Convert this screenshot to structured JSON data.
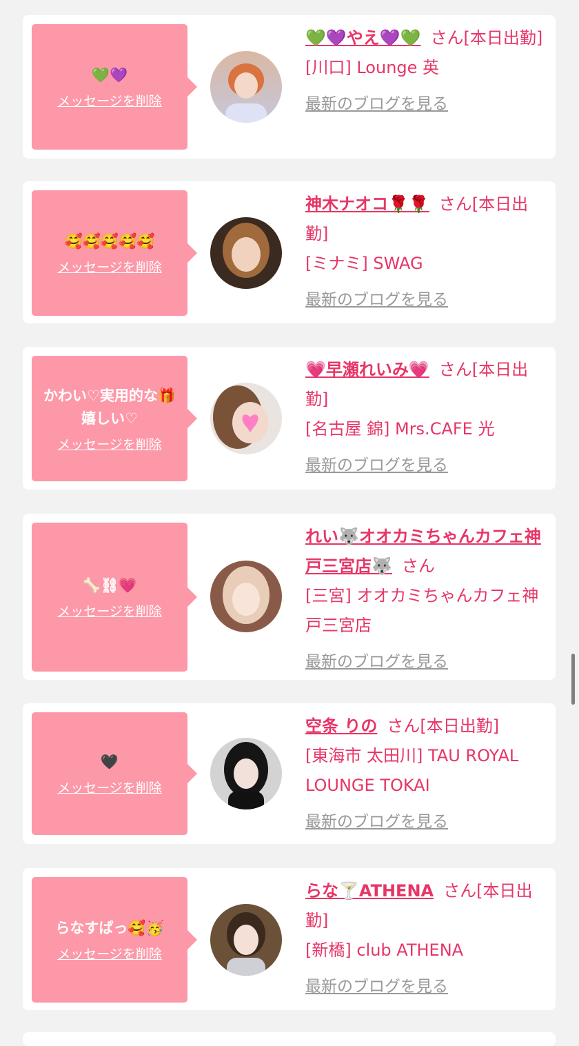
{
  "cards": [
    {
      "message": "💚💜",
      "delete_label": "メッセージを削除",
      "name": "💚💜やえ💜💚",
      "san": "さん",
      "status": "[本日出勤]",
      "place": "[川口] Lounge 英",
      "blog": "最新のブログを見る"
    },
    {
      "message": "🥰🥰🥰🥰🥰",
      "delete_label": "メッセージを削除",
      "name": "神木ナオコ🌹🌹",
      "san": "さん",
      "status": "[本日出勤]",
      "place": "[ミナミ] SWAG",
      "blog": "最新のブログを見る"
    },
    {
      "message": "かわい♡実用的な🎁嬉しい♡",
      "delete_label": "メッセージを削除",
      "name": "💗早瀬れいみ💗",
      "san": "さん",
      "status": "[本日出勤]",
      "place": "[名古屋 錦] Mrs.CAFE 光",
      "blog": "最新のブログを見る"
    },
    {
      "message": "🦴⛓💗",
      "delete_label": "メッセージを削除",
      "name": "れい🐺オオカミちゃんカフェ神戸三宮店🐺",
      "san": "さん",
      "status": "",
      "place": "[三宮] オオカミちゃんカフェ神戸三宮店",
      "blog": "最新のブログを見る"
    },
    {
      "message": "🖤",
      "delete_label": "メッセージを削除",
      "name": "空条 りの",
      "san": "さん",
      "status": "[本日出勤]",
      "place": "[東海市 太田川] TAU ROYAL LOUNGE TOKAI",
      "blog": "最新のブログを見る"
    },
    {
      "message": "らなすぱっ🥰🥳",
      "delete_label": "メッセージを削除",
      "name": "らな🍸ATHENA",
      "san": "さん",
      "status": "[本日出勤]",
      "place": "[新橋] club ATHENA",
      "blog": "最新のブログを見る"
    }
  ]
}
